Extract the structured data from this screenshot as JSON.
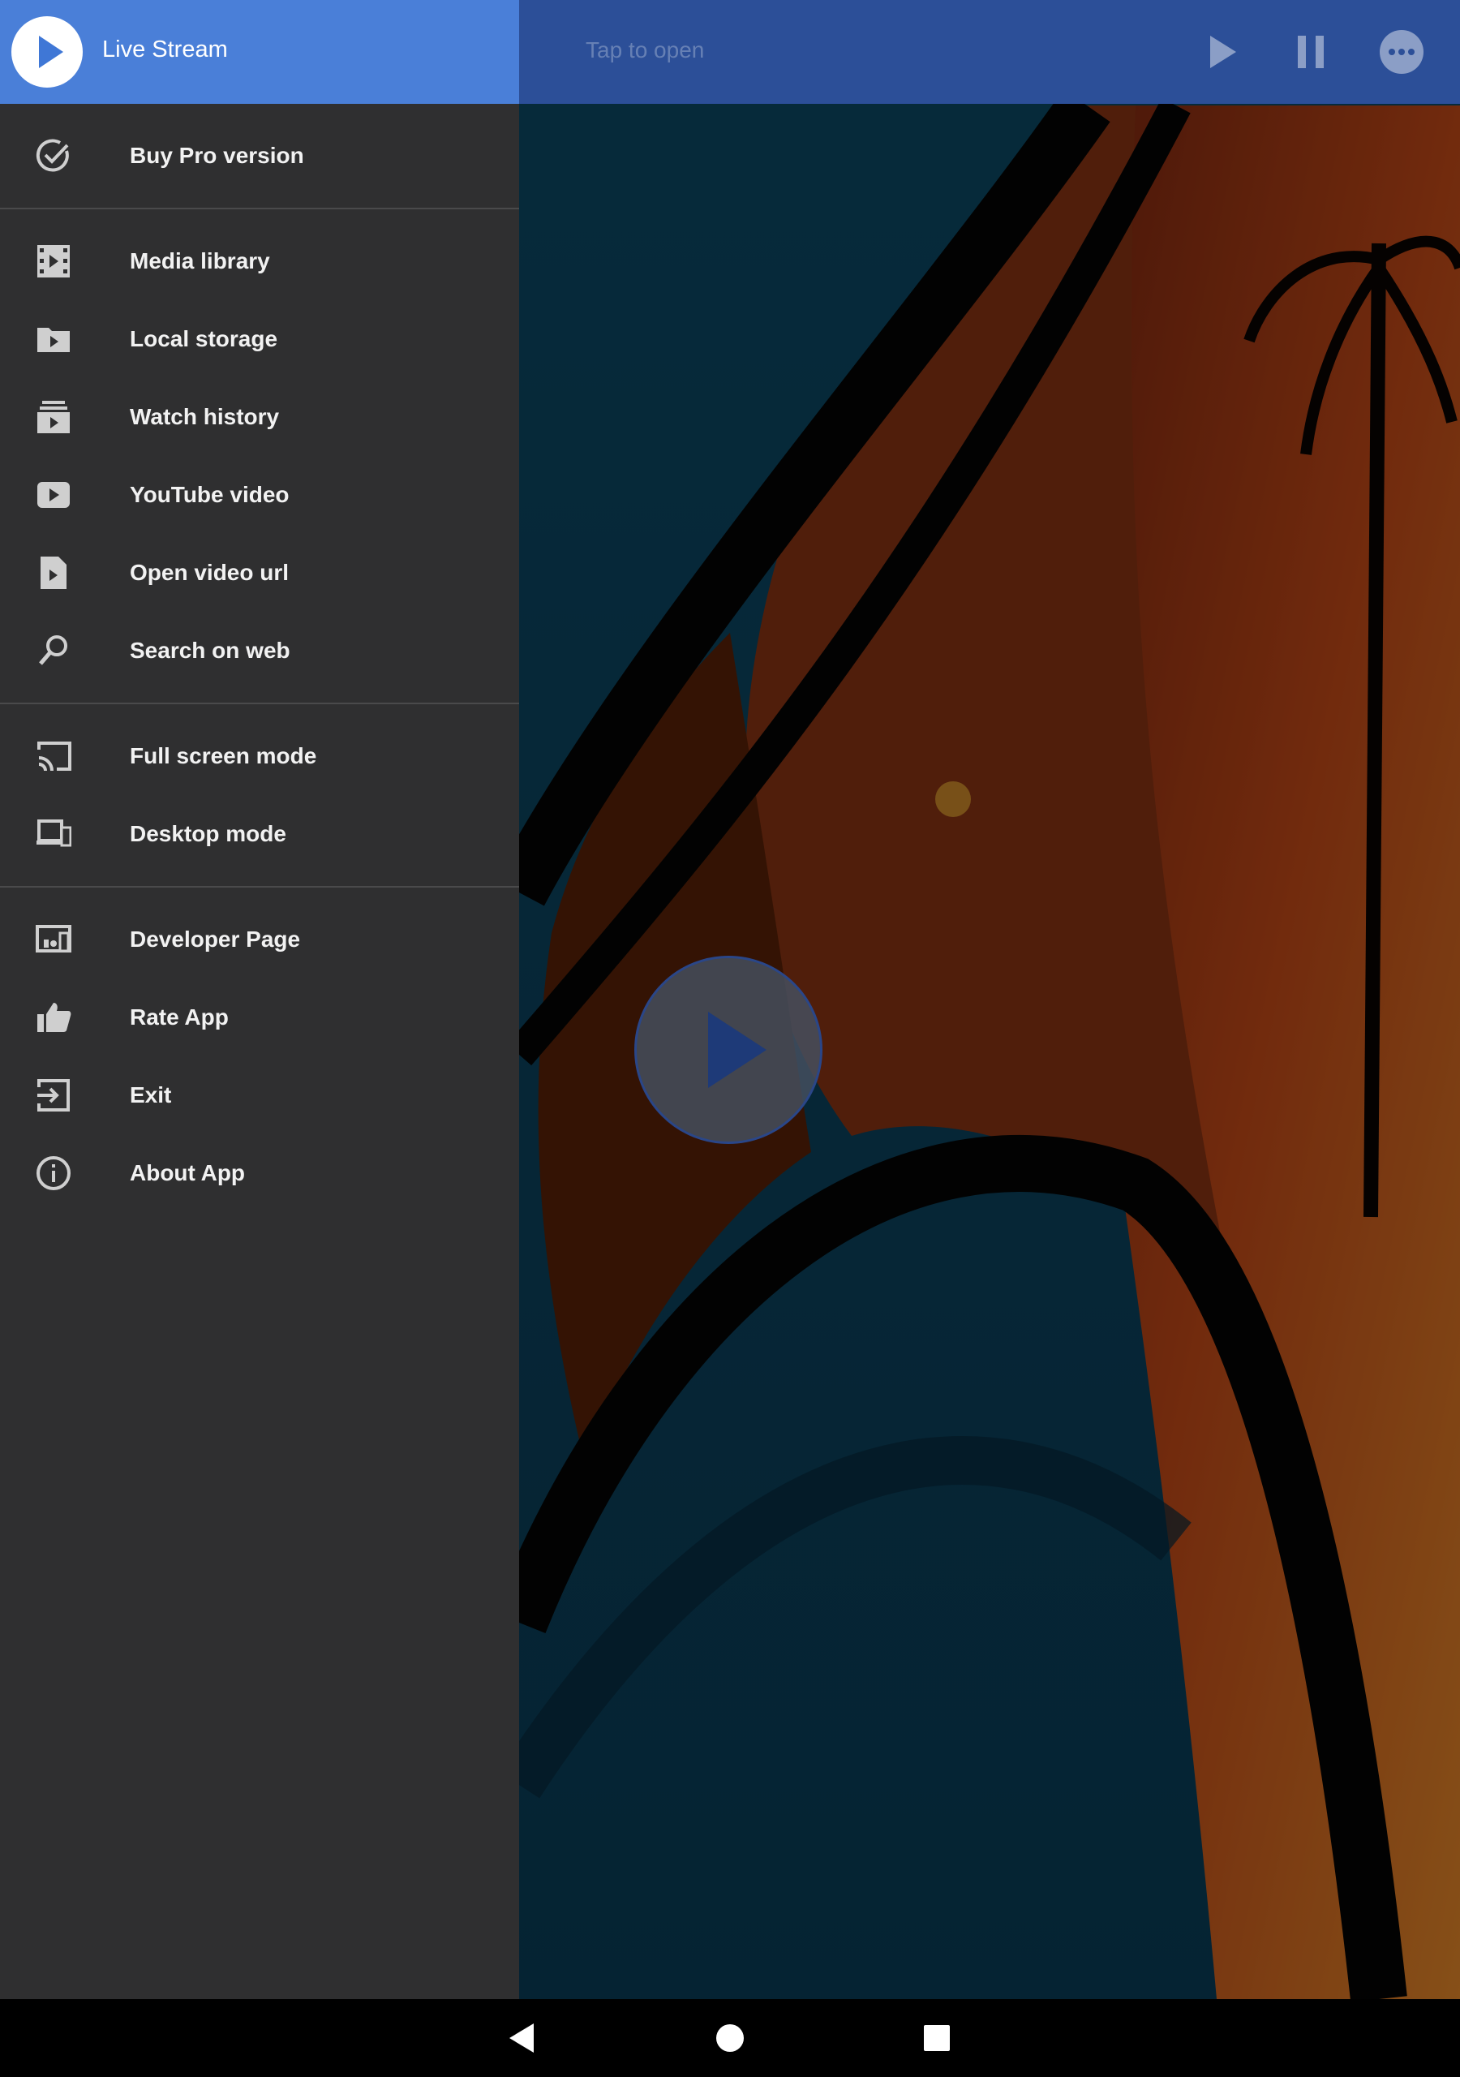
{
  "app_bar": {
    "hint": "Tap to open",
    "icons": [
      "play-icon",
      "pause-icon",
      "more-icon"
    ]
  },
  "drawer": {
    "header": {
      "title": "Live Stream",
      "icon": "play-circle-icon"
    },
    "sections": [
      [
        {
          "label": "Buy Pro version",
          "icon": "check-circle-icon"
        }
      ],
      [
        {
          "label": "Media library",
          "icon": "film-icon"
        },
        {
          "label": "Local storage",
          "icon": "folder-play-icon"
        },
        {
          "label": "Watch history",
          "icon": "history-icon"
        },
        {
          "label": "YouTube video",
          "icon": "youtube-icon"
        },
        {
          "label": "Open video url",
          "icon": "file-play-icon"
        },
        {
          "label": "Search on web",
          "icon": "search-icon"
        }
      ],
      [
        {
          "label": "Full screen mode",
          "icon": "cast-icon"
        },
        {
          "label": "Desktop mode",
          "icon": "devices-icon"
        }
      ],
      [
        {
          "label": "Developer Page",
          "icon": "developer-icon"
        },
        {
          "label": "Rate App",
          "icon": "thumb-up-icon"
        },
        {
          "label": "Exit",
          "icon": "exit-icon"
        },
        {
          "label": "About App",
          "icon": "info-icon"
        }
      ]
    ]
  },
  "system_nav": {
    "buttons": [
      "back-icon",
      "home-icon",
      "recents-icon"
    ]
  },
  "colors": {
    "drawer_header": "#4a7fd8",
    "app_bar": "#2c4f98",
    "drawer_bg": "#2f2f30",
    "label": "#f2f2f2"
  }
}
